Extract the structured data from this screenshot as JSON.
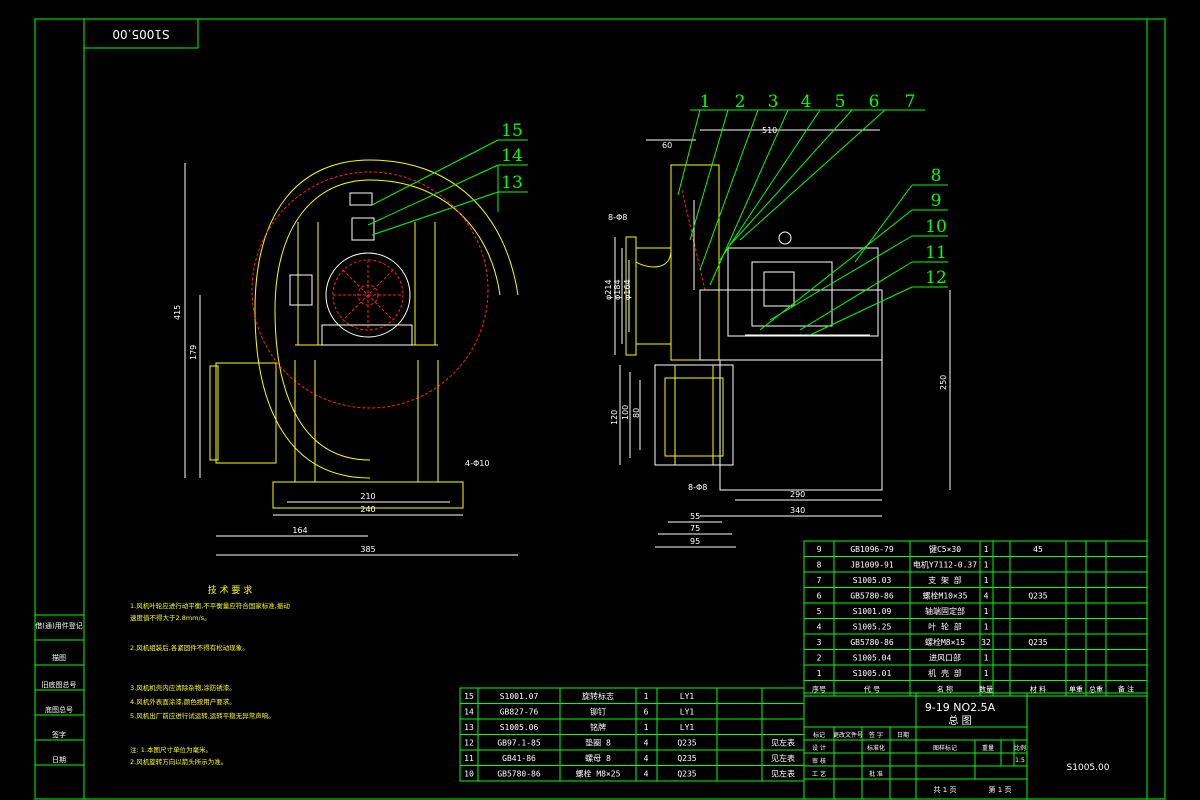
{
  "drawing": {
    "mirrored_number": "S1005.00",
    "title_line1": "9-19 NO2.5A",
    "title_line2": "总  图",
    "drawing_number": "S1005.00",
    "scale_cell": "1:5",
    "sheet_total": "共 1 页",
    "sheet_index": "第 1 页"
  },
  "callouts": [
    "1",
    "2",
    "3",
    "4",
    "5",
    "6",
    "7",
    "8",
    "9",
    "10",
    "11",
    "12",
    "13",
    "14",
    "15"
  ],
  "dimensions": {
    "front": {
      "height_415": "415",
      "height_179": "179",
      "width_210": "210",
      "width_240": "240",
      "width_164": "164",
      "width_385": "385",
      "holes": "4-Φ10"
    },
    "side": {
      "top_60": "60",
      "top_510": "510",
      "phi214": "φ214",
      "phi184": "φ184",
      "phi164": "φ164",
      "phi_8": "8-Φ8",
      "h120": "120",
      "h100": "100",
      "h80": "80",
      "h250": "250",
      "w290": "290",
      "w340": "340",
      "w55": "55",
      "w75": "75",
      "w95": "95",
      "holes": "8-Φ8"
    }
  },
  "tech_requirements": {
    "heading": "技 术 要 求",
    "lines": [
      "1.风机叶轮应进行动平衡,不平衡量应符合国家标准,振动",
      "  速度值不得大于2.8mm/s。",
      "2.风机组装后,各紧固件不得有松动现象。",
      "3.风机机壳内应清除杂物,涂防锈漆。",
      "4.风机外表面涂漆,颜色按用户要求。",
      "5.风机出厂前应进行试运转,运转平稳无异常声响。",
      "注: 1.本图尺寸单位为毫米。",
      "    2.风机旋转方向以箭头所示为准。"
    ]
  },
  "left_strip": [
    "借(通)用件登记",
    "旧底图总号",
    "签字",
    "日期",
    "描图",
    "描校",
    "底图总号"
  ],
  "bom_upper": {
    "rows": [
      [
        "9",
        "GB1096-79",
        "键C5×30",
        "1",
        "",
        "45",
        "",
        ""
      ],
      [
        "8",
        "JB1009-91",
        "电机Y7112-0.37",
        "1",
        "",
        "",
        "",
        ""
      ],
      [
        "7",
        "S1005.03",
        "支 架 部",
        "1",
        "",
        "",
        "",
        ""
      ],
      [
        "6",
        "GB5780-86",
        "螺栓M10×35",
        "4",
        "",
        "Q235",
        "",
        ""
      ],
      [
        "5",
        "S1001.09",
        "轴端固定部",
        "1",
        "",
        "",
        "",
        ""
      ],
      [
        "4",
        "S1005.25",
        "叶 轮 部",
        "1",
        "",
        "",
        "",
        ""
      ],
      [
        "3",
        "GB5780-86",
        "螺栓M8×15",
        "32",
        "",
        "Q235",
        "",
        ""
      ],
      [
        "2",
        "S1005.04",
        "进风口部",
        "1",
        "",
        "",
        "",
        ""
      ],
      [
        "1",
        "S1005.01",
        "机 壳 部",
        "1",
        "",
        "",
        "",
        ""
      ]
    ],
    "header": [
      "序号",
      "代 号",
      "名 称",
      "数量",
      "材 料",
      "",
      "单重",
      "总重",
      "备 注"
    ]
  },
  "bom_lower": {
    "rows": [
      [
        "15",
        "S1001.07",
        "旋转标志",
        "1",
        "LY1",
        ""
      ],
      [
        "14",
        "GB827-76",
        "铆钉",
        "6",
        "LY1",
        ""
      ],
      [
        "13",
        "S1005.06",
        "铭牌",
        "1",
        "LY1",
        ""
      ],
      [
        "12",
        "GB97.1-85",
        "垫圈 8",
        "4",
        "Q235",
        "见左表"
      ],
      [
        "11",
        "GB41-86",
        "螺母 8",
        "4",
        "Q235",
        "见左表"
      ],
      [
        "10",
        "GB5780-86",
        "螺栓 M8×25",
        "4",
        "Q235",
        "见左表"
      ]
    ]
  },
  "title_block": {
    "labels": [
      "标记",
      "处数",
      "更改文件号",
      "签 字",
      "日期",
      "设 计",
      "标准化",
      "审 核",
      "工 艺",
      "批 准",
      "图样标记",
      "重量",
      "比例",
      "日期"
    ]
  }
}
